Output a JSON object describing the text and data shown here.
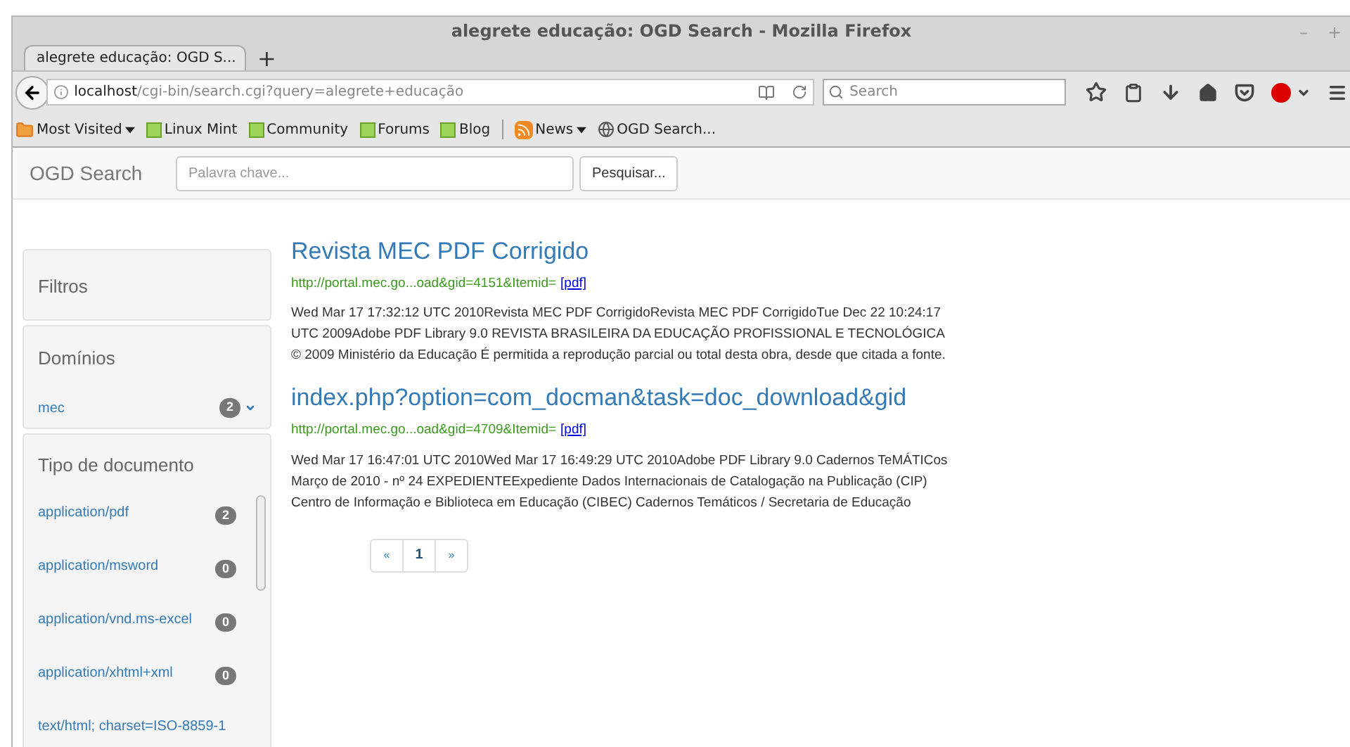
{
  "window": {
    "title": "alegrete educação: OGD Search - Mozilla Firefox",
    "controls": [
      "–",
      "+"
    ]
  },
  "tabs": [
    {
      "label": "alegrete educação: OGD S...",
      "selected": true
    }
  ],
  "new_tab": "+",
  "address_bar": {
    "host": "localhost",
    "path": "/cgi-bin/search.cgi?query=alegrete+educação"
  },
  "search_box": {
    "placeholder": "Search"
  },
  "bookmarks": [
    {
      "kind": "folder",
      "label": "Most Visited",
      "dropdown": true
    },
    {
      "kind": "mint",
      "label": "Linux Mint",
      "dropdown": false
    },
    {
      "kind": "mint",
      "label": "Community",
      "dropdown": false
    },
    {
      "kind": "mint",
      "label": "Forums",
      "dropdown": false
    },
    {
      "kind": "mint",
      "label": "Blog",
      "dropdown": false
    },
    {
      "kind": "rss",
      "label": "News",
      "dropdown": true
    },
    {
      "kind": "globe",
      "label": "OGD Search...",
      "dropdown": false
    }
  ],
  "page": {
    "brand": "OGD Search",
    "search": {
      "placeholder": "Palavra chave..."
    },
    "search_button": "Pesquisar...",
    "filters_title": "Filtros",
    "domains": {
      "title": "Domínios",
      "items": [
        {
          "label": "mec",
          "count": "2"
        }
      ]
    },
    "doc_types": {
      "title": "Tipo de documento",
      "items": [
        {
          "label": "application/pdf",
          "count": "2"
        },
        {
          "label": "application/msword",
          "count": "0"
        },
        {
          "label": "application/vnd.ms-excel",
          "count": "0"
        },
        {
          "label": "application/xhtml+xml",
          "count": "0"
        },
        {
          "label": "text/html; charset=ISO-8859-1"
        }
      ]
    },
    "results": [
      {
        "title": "Revista MEC PDF Corrigido",
        "url": "http://portal.mec.go...oad&gid=4151&Itemid=",
        "link": "[pdf]",
        "snippet": "Wed Mar 17 17:32:12 UTC 2010Revista MEC PDF CorrigidoRevista MEC PDF CorrigidoTue Dec 22 10:24:17 UTC 2009Adobe PDF Library 9.0 REVISTA BRASILEIRA DA EDUCAÇÃO PROFISSIONAL E TECNOLÓGICA © 2009 Ministério da Educação É permitida a reprodução parcial ou total desta obra, desde que citada a fonte."
      },
      {
        "title": "index.php?option=com_docman&task=doc_download&gid",
        "url": "http://portal.mec.go...oad&gid=4709&Itemid=",
        "link": "[pdf]",
        "snippet": "Wed Mar 17 16:47:01 UTC 2010Wed Mar 17 16:49:29 UTC 2010Adobe PDF Library 9.0 Cadernos TeMÁTICos Março de 2010 - nº 24 EXPEDIENTEExpediente Dados Internacionais de Catalogação na Publicação (CIP) Centro de Informação e Biblioteca em Educação (CIBEC) Cadernos Temáticos / Secretaria de Educação"
      }
    ],
    "pagination": [
      {
        "label": "«",
        "selected": false
      },
      {
        "label": "1",
        "selected": true
      },
      {
        "label": "»",
        "selected": false
      }
    ]
  }
}
